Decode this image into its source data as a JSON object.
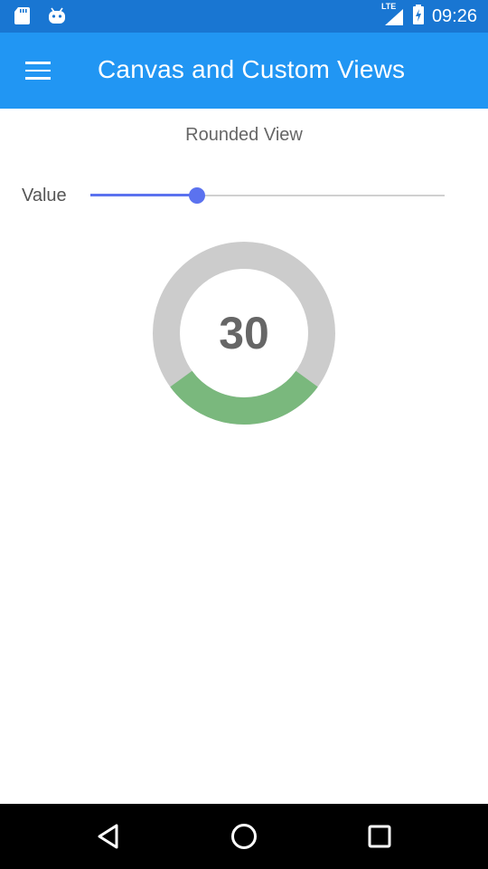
{
  "status_bar": {
    "time": "09:26",
    "network_label": "LTE",
    "icons": [
      "sd-card-icon",
      "android-icon",
      "lte-signal-icon",
      "battery-charging-icon"
    ]
  },
  "app_bar": {
    "title": "Canvas and Custom Views",
    "menu_icon": "hamburger-menu-icon"
  },
  "main": {
    "heading": "Rounded View",
    "slider": {
      "label": "Value",
      "value": 30,
      "max": 100
    },
    "gauge": {
      "value_text": "30",
      "value_fraction": 0.3,
      "track_color": "#cccccc",
      "fill_color": "#7ab87d",
      "text_color": "#666666"
    }
  },
  "nav_bar": {
    "icons": [
      "back-icon",
      "home-icon",
      "recents-icon"
    ]
  },
  "colors": {
    "status_bar": "#1976d2",
    "app_bar": "#2196f3",
    "slider_accent": "#5b72ef"
  }
}
